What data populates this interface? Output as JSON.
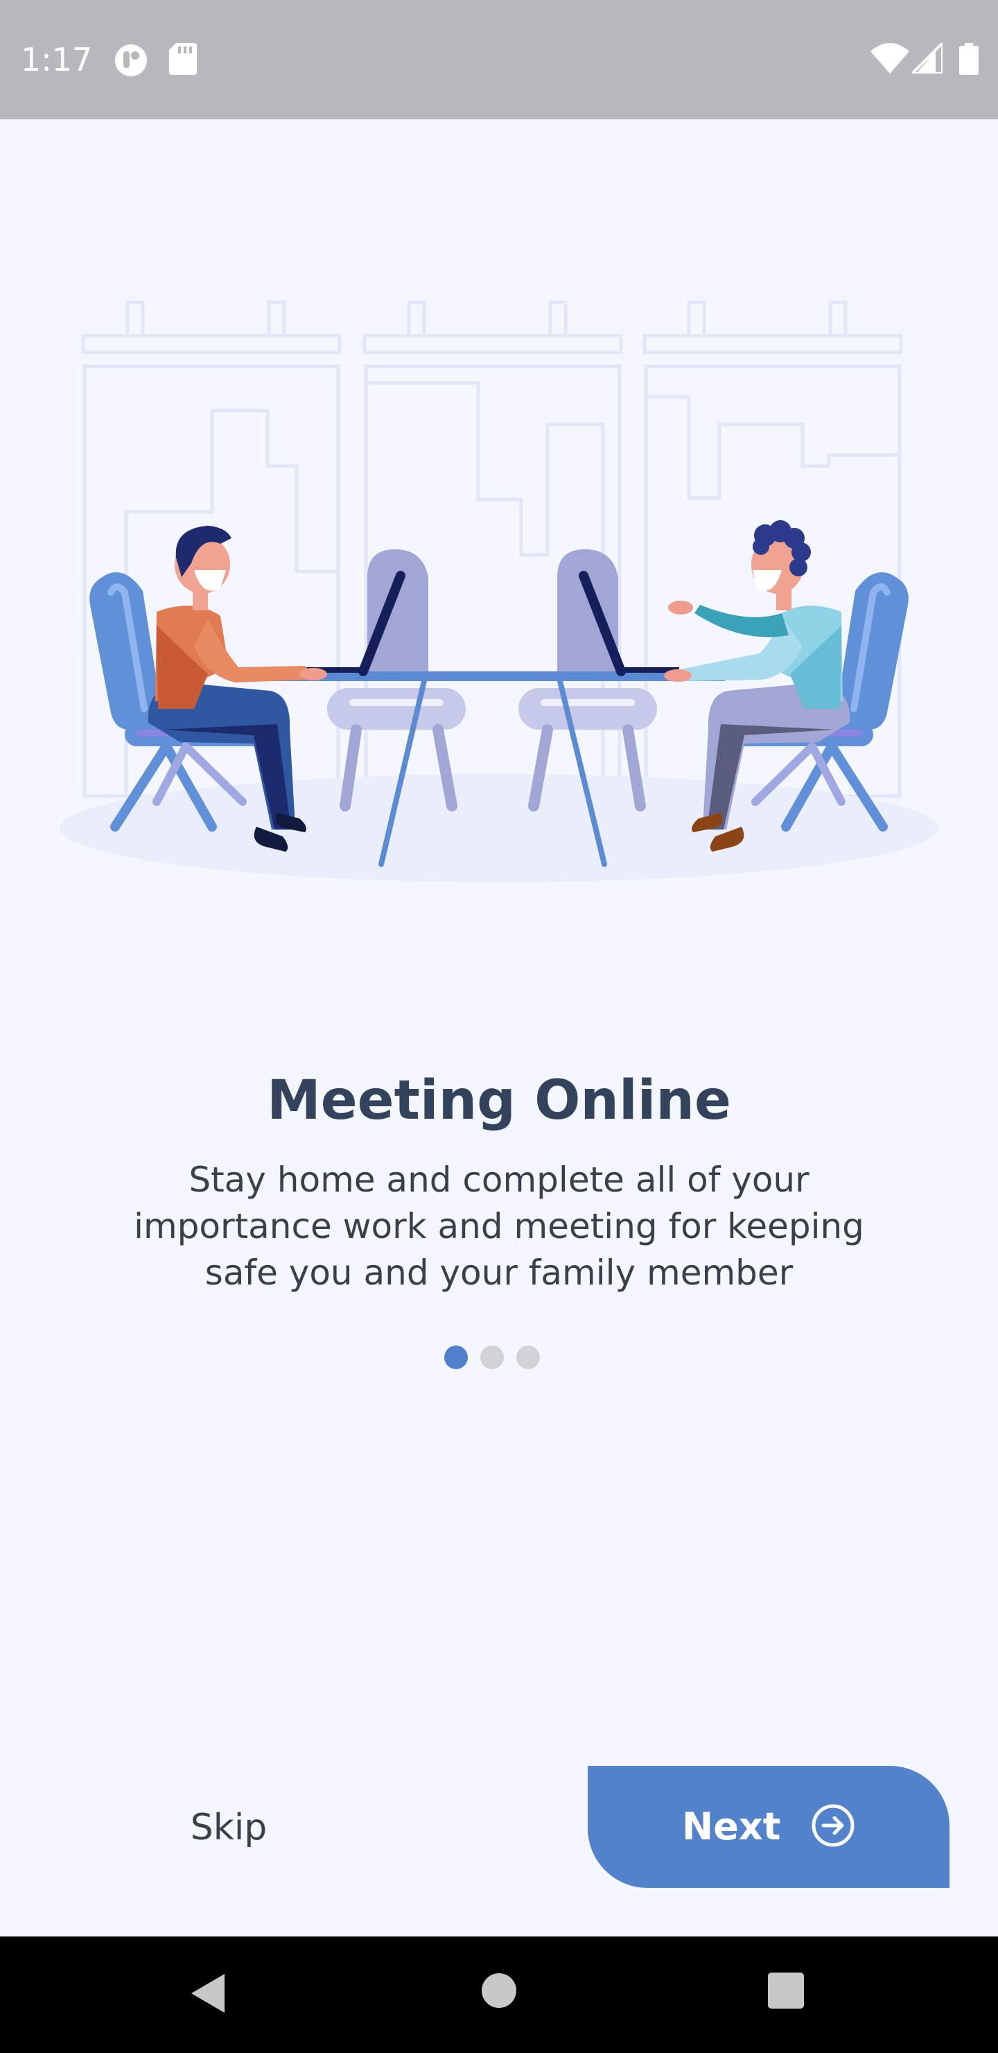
{
  "status_bar": {
    "time": "1:17",
    "icons": [
      "notification-app-icon",
      "sd-card-icon",
      "wifi-icon",
      "cell-signal-icon",
      "battery-icon"
    ]
  },
  "illustration": {
    "name": "meeting-illustration",
    "palette": {
      "background_lines": "#e3e6f9",
      "chair": "#5c8ad3",
      "desk": "#5c8ad3",
      "shield": "#a2a6d4",
      "person_left_shirt": "#e07a51",
      "person_right_shirt": "#8ed2e6"
    }
  },
  "onboarding": {
    "title": "Meeting Online",
    "description_lines": [
      "Stay home and complete all of your",
      "importance work and meeting for keeping",
      "safe you and your family member"
    ],
    "page_index": 1,
    "page_count": 3
  },
  "actions": {
    "skip_label": "Skip",
    "next_label": "Next",
    "next_icon": "arrow-right-circle-icon"
  },
  "nav_bar": {
    "buttons": [
      "back-icon",
      "home-icon",
      "recents-icon"
    ]
  },
  "colors": {
    "accent": "#5282cc",
    "title": "#34435c",
    "background": "#f4f7fe",
    "status_bar": "#b8b9bd"
  }
}
